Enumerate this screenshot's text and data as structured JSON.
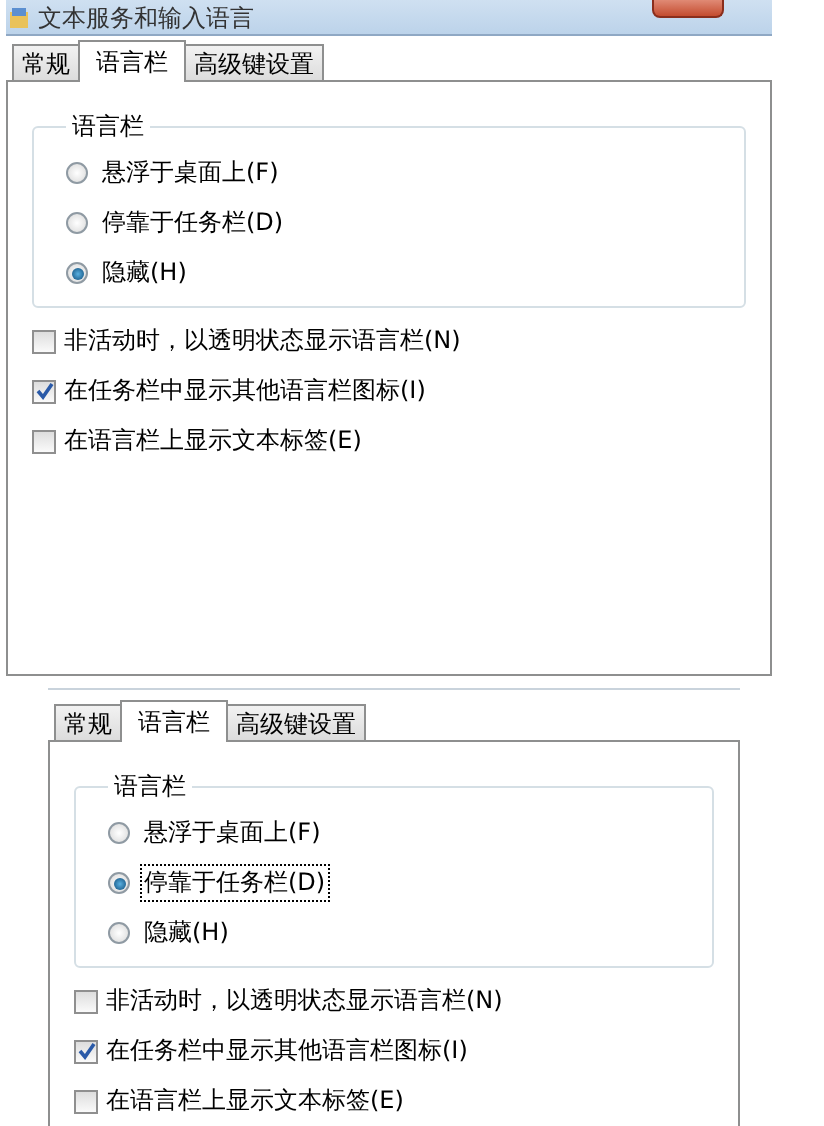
{
  "panels": [
    {
      "window": {
        "title": "文本服务和输入语言"
      },
      "tabs": [
        {
          "label": "常规",
          "selected": false
        },
        {
          "label": "语言栏",
          "selected": true
        },
        {
          "label": "高级键设置",
          "selected": false
        }
      ],
      "group": {
        "label": "语言栏",
        "options": [
          {
            "label": "悬浮于桌面上(F)",
            "selected": false,
            "focused": false
          },
          {
            "label": "停靠于任务栏(D)",
            "selected": false,
            "focused": false
          },
          {
            "label": "隐藏(H)",
            "selected": true,
            "focused": false
          }
        ]
      },
      "checks": [
        {
          "label": "非活动时，以透明状态显示语言栏(N)",
          "checked": false
        },
        {
          "label": "在任务栏中显示其他语言栏图标(I)",
          "checked": true
        },
        {
          "label": "在语言栏上显示文本标签(E)",
          "checked": false
        }
      ]
    },
    {
      "tabs": [
        {
          "label": "常规",
          "selected": false
        },
        {
          "label": "语言栏",
          "selected": true
        },
        {
          "label": "高级键设置",
          "selected": false
        }
      ],
      "group": {
        "label": "语言栏",
        "options": [
          {
            "label": "悬浮于桌面上(F)",
            "selected": false,
            "focused": false
          },
          {
            "label": "停靠于任务栏(D)",
            "selected": true,
            "focused": true
          },
          {
            "label": "隐藏(H)",
            "selected": false,
            "focused": false
          }
        ]
      },
      "checks": [
        {
          "label": "非活动时，以透明状态显示语言栏(N)",
          "checked": false
        },
        {
          "label": "在任务栏中显示其他语言栏图标(I)",
          "checked": true
        },
        {
          "label": "在语言栏上显示文本标签(E)",
          "checked": false
        }
      ]
    }
  ]
}
